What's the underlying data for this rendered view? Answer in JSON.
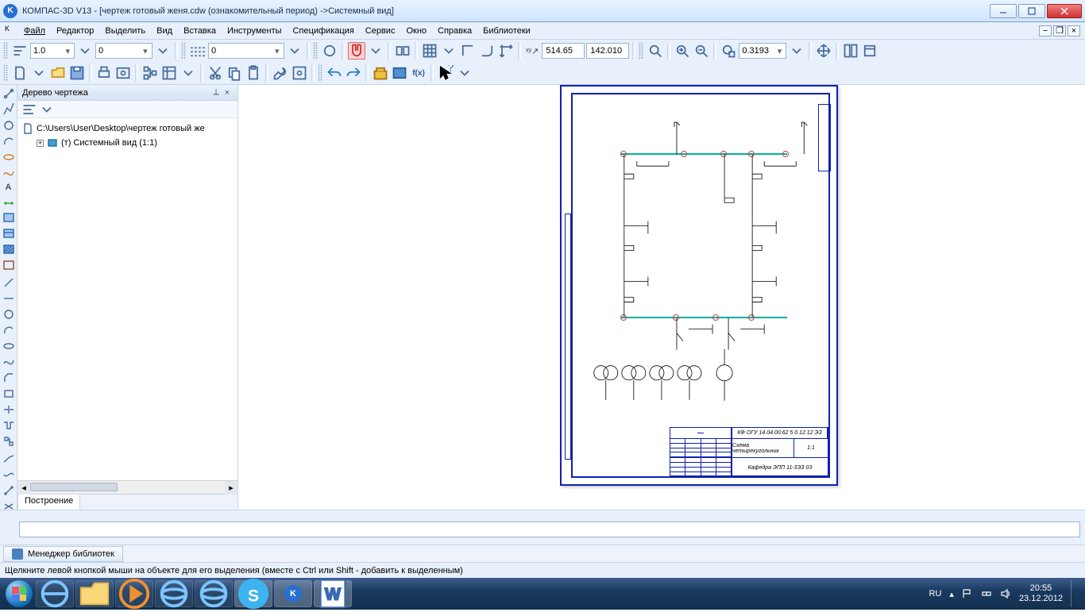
{
  "window": {
    "title": "КОМПАС-3D V13 - [чертеж готовый женя.cdw (ознакомительный период) ->Системный вид]"
  },
  "menu": {
    "items": [
      "Файл",
      "Редактор",
      "Выделить",
      "Вид",
      "Вставка",
      "Инструменты",
      "Спецификация",
      "Сервис",
      "Окно",
      "Справка",
      "Библиотеки"
    ]
  },
  "toolbar": {
    "scale": "1.0",
    "layer": "0",
    "style": "0",
    "coord_x": "514.65",
    "coord_y": "142.010",
    "zoom": "0.3193"
  },
  "tree": {
    "title": "Дерево чертежа",
    "file": "C:\\Users\\User\\Desktop\\чертеж готовый же",
    "view": "(т) Системный вид (1:1)"
  },
  "panetab": "Построение",
  "libtab": "Менеджер библиотек",
  "status": "Щелкните левой кнопкой мыши на объекте для его выделения (вместе с Ctrl или Shift - добавить к выделенным)",
  "titleblock": {
    "code": "КФ ОГУ 14.04.00.62  5 0  12.12  ЭЗ",
    "name": "Схема четырехугольник",
    "dept": "Кафедра ЭПП 11-3ЭЗ 03",
    "scale": "1:1"
  },
  "tray": {
    "lang": "RU",
    "time": "20:55",
    "date": "23.12.2012"
  }
}
